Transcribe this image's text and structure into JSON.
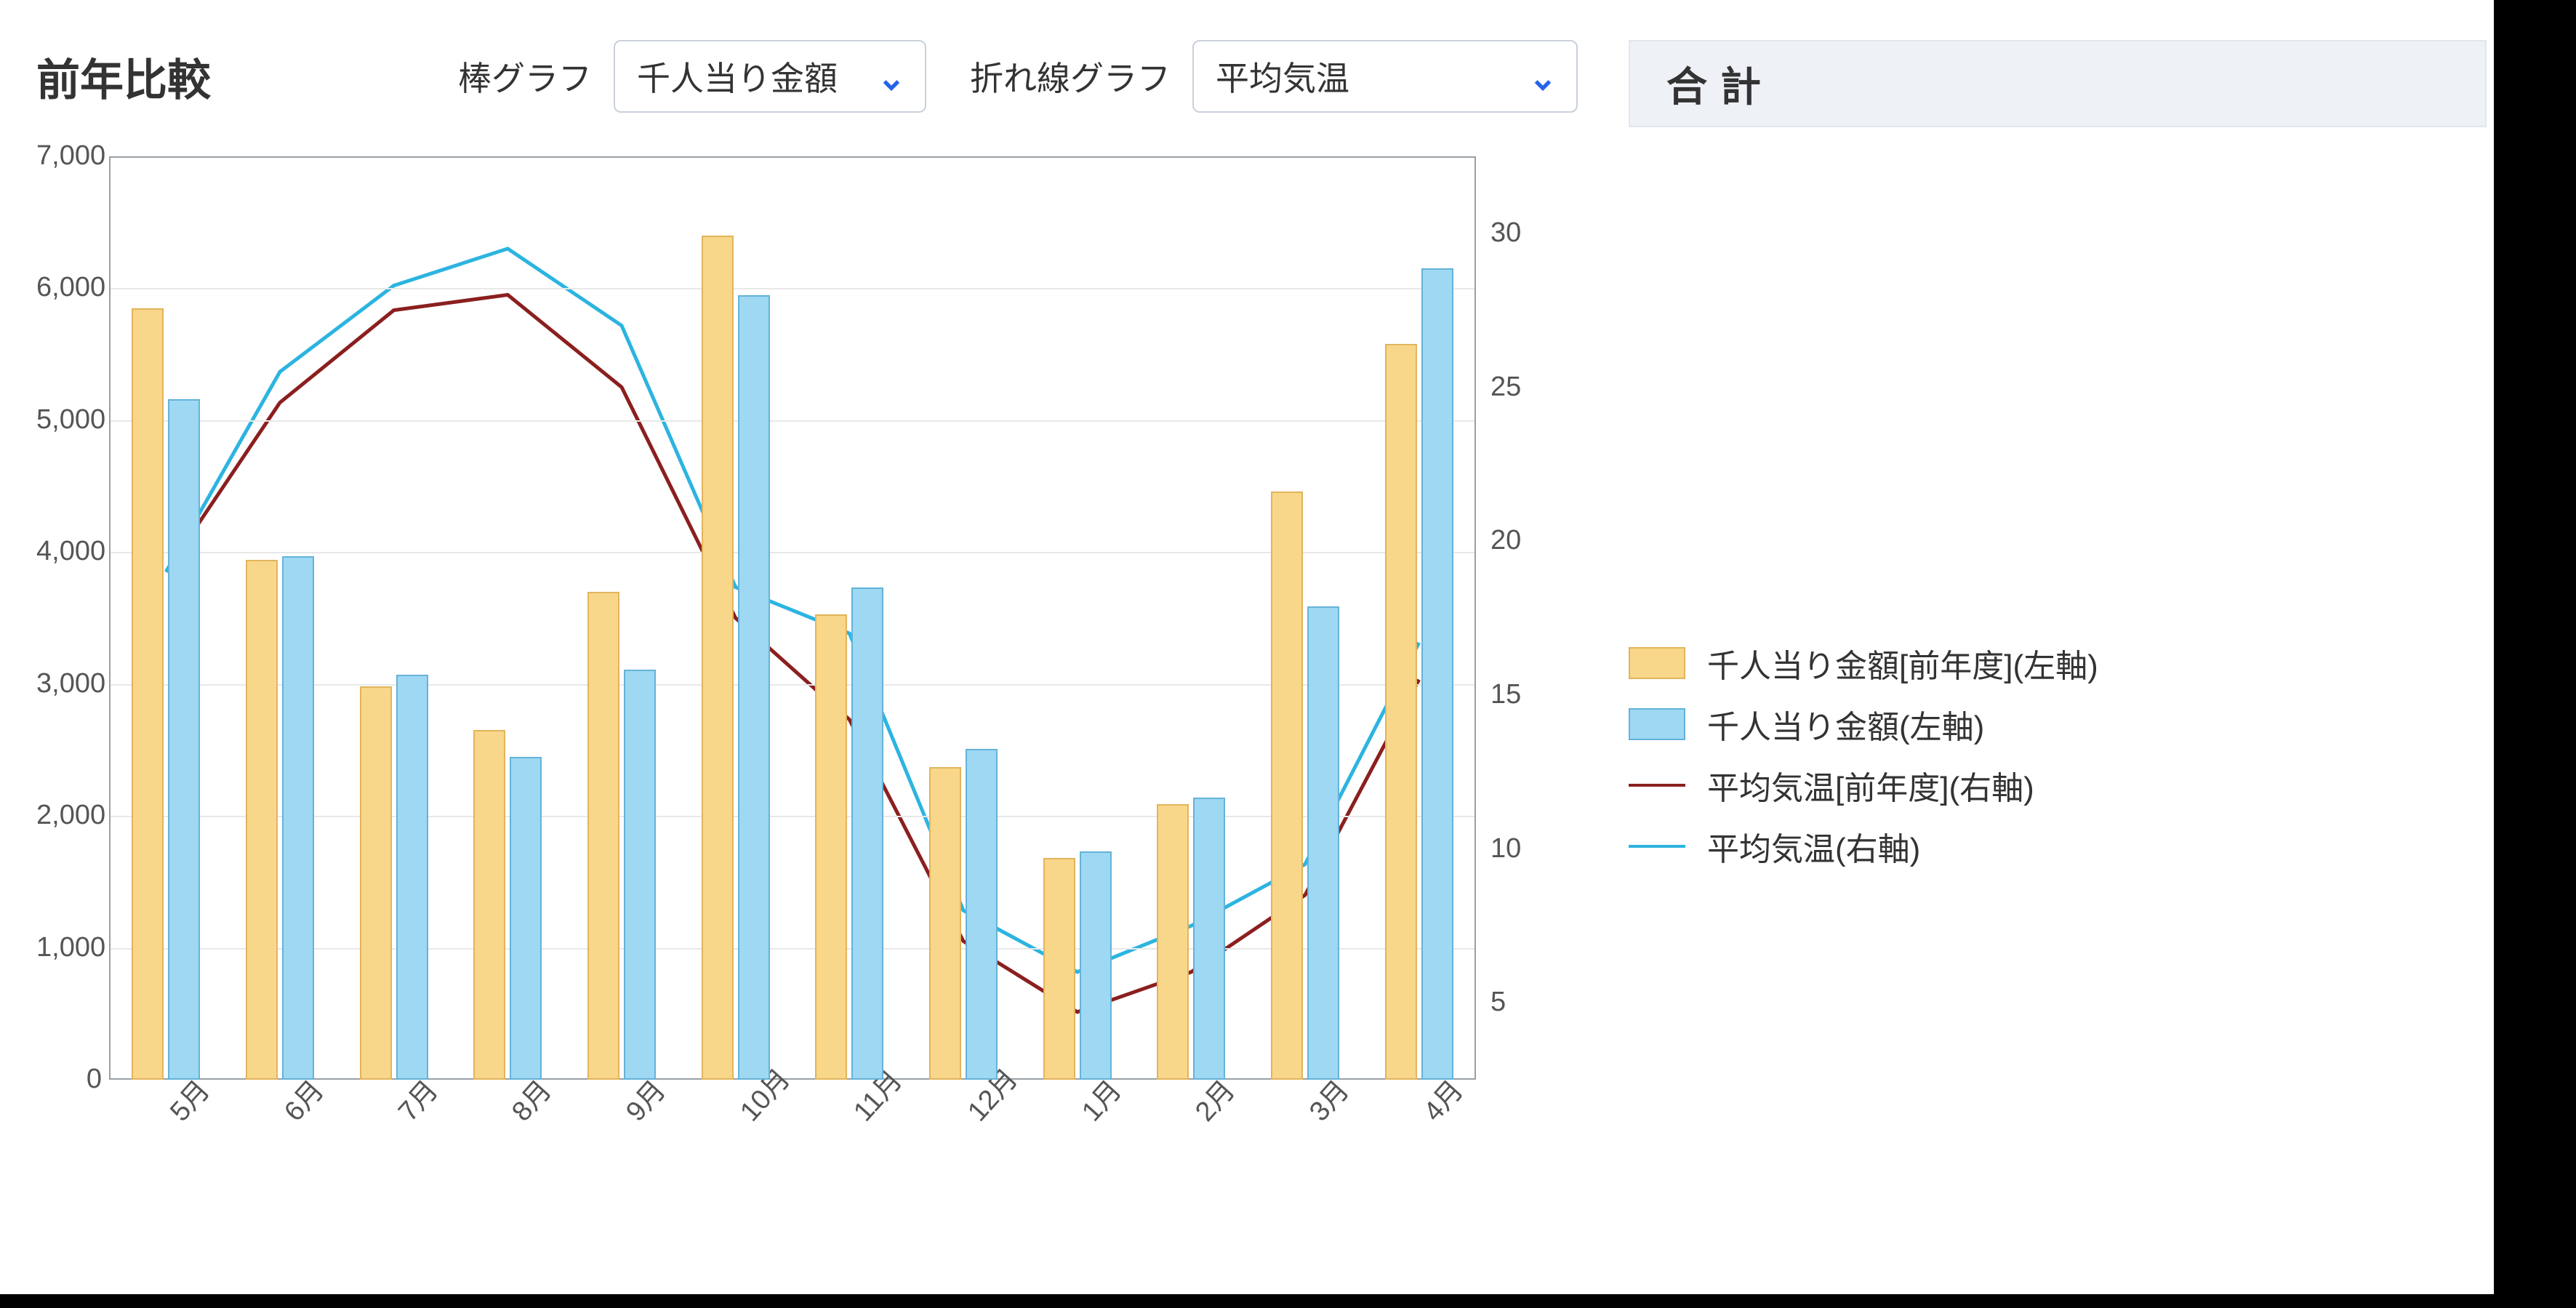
{
  "title": "前年比較",
  "controls": {
    "bar_label": "棒グラフ",
    "bar_select": "千人当り金額",
    "line_label": "折れ線グラフ",
    "line_select": "平均気温"
  },
  "totals_label": "合計",
  "legend": {
    "prev_bar": "千人当り金額[前年度](左軸)",
    "cur_bar": "千人当り金額(左軸)",
    "prev_line": "平均気温[前年度](右軸)",
    "cur_line": "平均気温(右軸)"
  },
  "chart_data": {
    "type": "bar+line",
    "categories": [
      "5月",
      "6月",
      "7月",
      "8月",
      "9月",
      "10月",
      "11月",
      "12月",
      "1月",
      "2月",
      "3月",
      "4月"
    ],
    "left_axis": {
      "min": 0,
      "max": 7000,
      "step": 1000
    },
    "right_axis": {
      "min": 2.5,
      "max": 32.5,
      "ticks": [
        5,
        10,
        15,
        20,
        25,
        30
      ]
    },
    "series": [
      {
        "name": "千人当り金額[前年度](左軸)",
        "axis": "left",
        "kind": "bar",
        "color": "#f8d78a",
        "values": [
          5850,
          3940,
          2980,
          2650,
          3700,
          6400,
          3530,
          2370,
          1680,
          2090,
          4460,
          5580
        ]
      },
      {
        "name": "千人当り金額(左軸)",
        "axis": "left",
        "kind": "bar",
        "color": "#9fd8f2",
        "values": [
          5160,
          3970,
          3070,
          2450,
          3110,
          5950,
          3730,
          2510,
          1730,
          2140,
          3590,
          6150
        ]
      },
      {
        "name": "平均気温[前年度](右軸)",
        "axis": "right",
        "kind": "line",
        "color": "#8b1f1f",
        "values": [
          19.0,
          24.5,
          27.5,
          28.0,
          25.0,
          17.5,
          14.2,
          7.0,
          4.7,
          6.0,
          8.5,
          15.5
        ]
      },
      {
        "name": "平均気温(右軸)",
        "axis": "right",
        "kind": "line",
        "color": "#2cb4e0",
        "values": [
          19.0,
          25.5,
          28.3,
          29.5,
          27.0,
          18.5,
          17.0,
          8.0,
          6.0,
          7.5,
          9.5,
          16.7
        ]
      }
    ]
  },
  "colors": {
    "accent": "#2563eb"
  }
}
